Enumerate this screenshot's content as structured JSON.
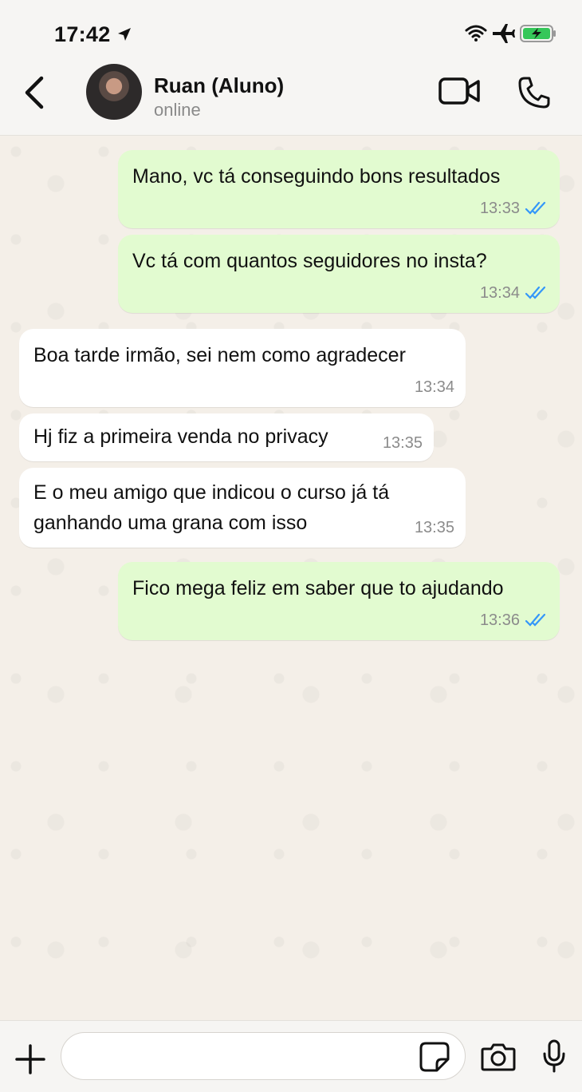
{
  "status_bar": {
    "time": "17:42",
    "icons": [
      "location-arrow-icon",
      "wifi-icon",
      "airplane-icon",
      "battery-charging-icon"
    ],
    "battery_color": "#35c759"
  },
  "header": {
    "contact_name": "Ruan (Aluno)",
    "contact_status": "online",
    "icons": [
      "back-chevron-icon",
      "video-call-icon",
      "phone-call-icon"
    ]
  },
  "messages": [
    {
      "direction": "out",
      "text": "Mano, vc tá conseguindo bons resultados",
      "time": "13:33",
      "status": "read"
    },
    {
      "direction": "out",
      "text": "Vc tá com quantos seguidores no insta?",
      "time": "13:34",
      "status": "read"
    },
    {
      "direction": "in",
      "text": "Boa tarde irmão, sei nem como agradecer",
      "time": "13:34"
    },
    {
      "direction": "in",
      "text": "Hj fiz a primeira venda no privacy",
      "time": "13:35"
    },
    {
      "direction": "in",
      "text": "E o meu amigo que indicou o curso já tá\nganhando uma grana com isso",
      "time": "13:35"
    },
    {
      "direction": "out",
      "text": "Fico mega feliz em saber que to ajudando",
      "time": "13:36",
      "status": "read"
    }
  ],
  "composer": {
    "placeholder": "",
    "icons": [
      "plus-icon",
      "sticker-icon",
      "camera-icon",
      "microphone-icon"
    ]
  },
  "colors": {
    "outgoing_bubble": "#e2fbd0",
    "incoming_bubble": "#ffffff",
    "read_tick": "#3497f9",
    "chat_background": "#f4efe8"
  }
}
